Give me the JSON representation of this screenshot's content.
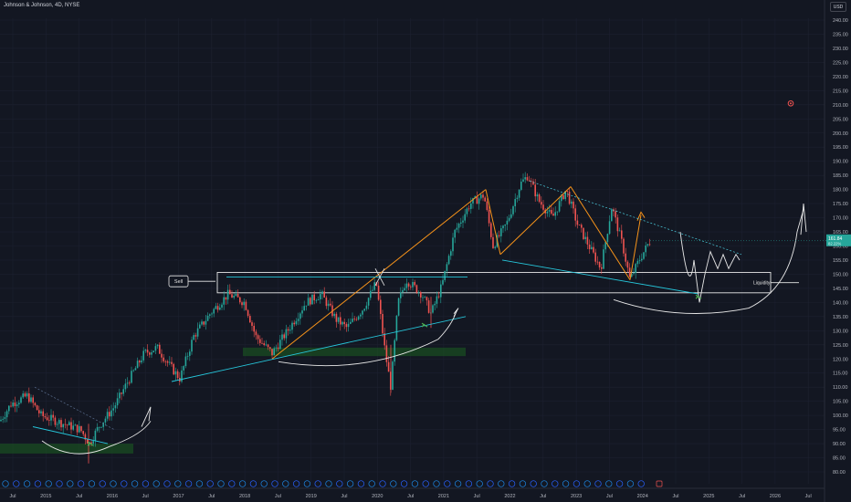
{
  "header": {
    "title": "Johnson & Johnson, 4D, NYSE",
    "currency_button": "USD"
  },
  "colors": {
    "background": "#131722",
    "grid": "#1c2030",
    "up": "#26a69a",
    "down": "#ef5350",
    "orange": "#f7931a",
    "teal": "#26c6da",
    "white": "#e8e8e8",
    "zone": "#1b5e20",
    "price_tag": "#26a69a"
  },
  "annotations": {
    "sell_label": "Sell",
    "liquidity_label": "Liquidity"
  },
  "price_tag": {
    "price": "161.84",
    "change": "82.22%"
  },
  "chart_data": {
    "type": "candlestick",
    "title": "Johnson & Johnson, 4D, NYSE",
    "ylim": [
      77,
      245
    ],
    "y_ticks": [
      80,
      85,
      90,
      95,
      100,
      105,
      110,
      115,
      120,
      125,
      130,
      135,
      140,
      145,
      150,
      155,
      160,
      165,
      170,
      175,
      180,
      185,
      190,
      195,
      200,
      205,
      210,
      215,
      220,
      225,
      230,
      235,
      240
    ],
    "x_ticks": [
      "Jul",
      "2015",
      "Jul",
      "2016",
      "Jul",
      "2017",
      "Jul",
      "2018",
      "Jul",
      "2019",
      "Jul",
      "2020",
      "Jul",
      "2021",
      "Jul",
      "2022",
      "Jul",
      "2023",
      "Jul",
      "2024",
      "Jul",
      "2025",
      "Jul",
      "2026",
      "Jul"
    ],
    "price_path": [
      [
        0,
        98
      ],
      [
        12,
        104
      ],
      [
        30,
        107
      ],
      [
        45,
        100
      ],
      [
        70,
        97
      ],
      [
        88,
        95
      ],
      [
        98,
        90
      ],
      [
        108,
        96
      ],
      [
        125,
        103
      ],
      [
        140,
        112
      ],
      [
        158,
        122
      ],
      [
        172,
        124
      ],
      [
        185,
        118
      ],
      [
        197,
        113
      ],
      [
        212,
        128
      ],
      [
        230,
        136
      ],
      [
        250,
        143
      ],
      [
        268,
        140
      ],
      [
        280,
        128
      ],
      [
        298,
        122
      ],
      [
        315,
        130
      ],
      [
        335,
        140
      ],
      [
        352,
        143
      ],
      [
        368,
        134
      ],
      [
        380,
        131
      ],
      [
        398,
        138
      ],
      [
        412,
        147
      ],
      [
        422,
        122
      ],
      [
        428,
        110
      ],
      [
        436,
        140
      ],
      [
        445,
        148
      ],
      [
        462,
        143
      ],
      [
        472,
        136
      ],
      [
        484,
        146
      ],
      [
        498,
        165
      ],
      [
        515,
        175
      ],
      [
        530,
        178
      ],
      [
        540,
        160
      ],
      [
        555,
        168
      ],
      [
        570,
        182
      ],
      [
        578,
        185
      ],
      [
        590,
        176
      ],
      [
        605,
        170
      ],
      [
        620,
        180
      ],
      [
        632,
        168
      ],
      [
        645,
        160
      ],
      [
        658,
        152
      ],
      [
        670,
        174
      ],
      [
        682,
        160
      ],
      [
        690,
        148
      ],
      [
        700,
        155
      ],
      [
        712,
        161.84
      ]
    ],
    "sell_zone": [
      146,
      150
    ],
    "liquidity_line": 147,
    "demand_zones": [
      [
        121,
        124
      ],
      [
        86.5,
        90
      ]
    ]
  }
}
